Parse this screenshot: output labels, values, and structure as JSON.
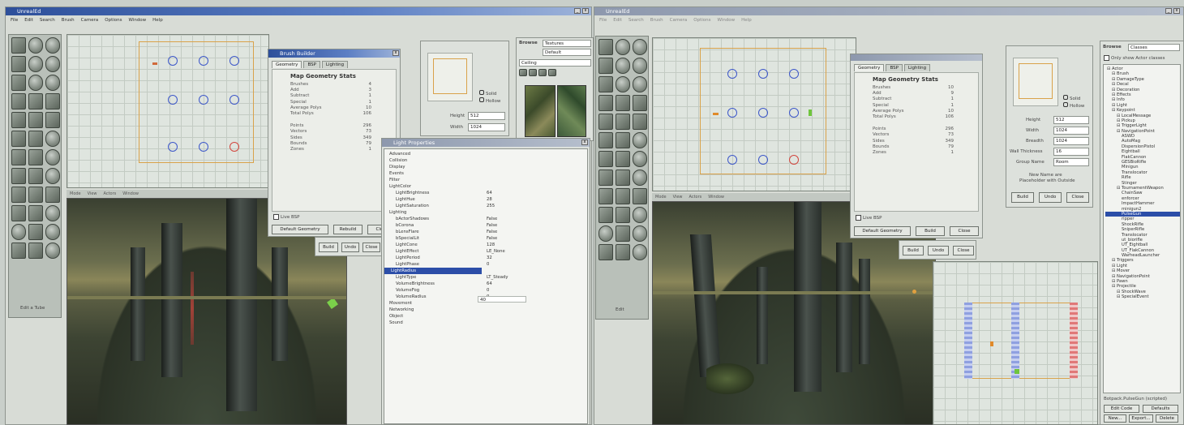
{
  "left_window": {
    "title": "UnrealEd",
    "menu": [
      "File",
      "Edit",
      "Search",
      "Brush",
      "Camera",
      "Options",
      "Window",
      "Help"
    ],
    "toolbox_caption": "Edit a Tube",
    "geometry_dialog": {
      "title": "Brush Builder",
      "tabs": [
        "Geometry",
        "BSP",
        "Lighting"
      ],
      "heading": "Map Geometry Stats",
      "stats": [
        {
          "label": "Brushes",
          "value": "4"
        },
        {
          "label": "Add",
          "value": "3"
        },
        {
          "label": "Subtract",
          "value": "1"
        },
        {
          "label": "Special",
          "value": "1"
        },
        {
          "label": "Average Polys",
          "value": "10"
        },
        {
          "label": "Total Polys",
          "value": "106"
        },
        {
          "label": "Points",
          "value": "296"
        },
        {
          "label": "Vectors",
          "value": "73"
        },
        {
          "label": "Sides",
          "value": "349"
        },
        {
          "label": "Bounds",
          "value": "79"
        },
        {
          "label": "Zones",
          "value": "1"
        }
      ],
      "checkbox_label": "Live BSP",
      "button_labels": [
        "Default Geometry",
        "Rebuild",
        "Close"
      ]
    },
    "sheet_panel": {
      "solid_label": "Solid",
      "hollow_label": "Hollow",
      "height_label": "Height",
      "height_value": "512",
      "width_label": "Width",
      "width_value": "1024",
      "button_labels": [
        "Build",
        "Undo",
        "Close"
      ]
    },
    "browser": {
      "label": "Browse",
      "value": "Textures",
      "sub1": "Default",
      "sub2": "Ceiling"
    },
    "viewport_menu": [
      "Mode",
      "View",
      "Actors",
      "Window"
    ]
  },
  "properties": {
    "title": "Light Properties",
    "rows": [
      {
        "key": "Advanced",
        "value": ""
      },
      {
        "key": "Collision",
        "value": ""
      },
      {
        "key": "Display",
        "value": ""
      },
      {
        "key": "Events",
        "value": ""
      },
      {
        "key": "Filter",
        "value": ""
      },
      {
        "key": "LightColor",
        "value": ""
      },
      {
        "key": "LightBrightness",
        "value": "64"
      },
      {
        "key": "LightHue",
        "value": "28"
      },
      {
        "key": "LightSaturation",
        "value": "255"
      },
      {
        "key": "Lighting",
        "value": ""
      },
      {
        "key": "bActorShadows",
        "value": "False"
      },
      {
        "key": "bCorona",
        "value": "False"
      },
      {
        "key": "bLensFlare",
        "value": "False"
      },
      {
        "key": "bSpecialLit",
        "value": "False"
      },
      {
        "key": "LightCone",
        "value": "128"
      },
      {
        "key": "LightEffect",
        "value": "LE_None"
      },
      {
        "key": "LightPeriod",
        "value": "32"
      },
      {
        "key": "LightPhase",
        "value": "0"
      },
      {
        "key": "LightRadius",
        "value": "40"
      },
      {
        "key": "LightType",
        "value": "LT_Steady"
      },
      {
        "key": "VolumeBrightness",
        "value": "64"
      },
      {
        "key": "VolumeFog",
        "value": "0"
      },
      {
        "key": "VolumeRadius",
        "value": "0"
      },
      {
        "key": "Movement",
        "value": ""
      },
      {
        "key": "Networking",
        "value": ""
      },
      {
        "key": "Object",
        "value": ""
      },
      {
        "key": "Sound",
        "value": ""
      }
    ]
  },
  "right_window": {
    "title": "UnrealEd",
    "menu": [
      "File",
      "Edit",
      "Search",
      "Brush",
      "Camera",
      "Options",
      "Window",
      "Help"
    ],
    "toolbox_caption": "Edit",
    "geometry_dialog": {
      "tabs": [
        "Geometry",
        "BSP",
        "Lighting"
      ],
      "heading": "Map Geometry Stats",
      "stats": [
        {
          "label": "Brushes",
          "value": "10"
        },
        {
          "label": "Add",
          "value": "9"
        },
        {
          "label": "Subtract",
          "value": "1"
        },
        {
          "label": "Special",
          "value": "1"
        },
        {
          "label": "Average Polys",
          "value": "10"
        },
        {
          "label": "Total Polys",
          "value": "106"
        },
        {
          "label": "Points",
          "value": "296"
        },
        {
          "label": "Vectors",
          "value": "73"
        },
        {
          "label": "Sides",
          "value": "349"
        },
        {
          "label": "Bounds",
          "value": "79"
        },
        {
          "label": "Zones",
          "value": "1"
        }
      ],
      "checkbox_label": "Live BSP",
      "button_labels": [
        "Default Geometry",
        "Build",
        "Close"
      ]
    },
    "sheet_panel": {
      "solid_label": "Solid",
      "hollow_label": "Hollow",
      "fields": [
        {
          "label": "Height",
          "value": "512"
        },
        {
          "label": "Width",
          "value": "1024"
        },
        {
          "label": "Breadth",
          "value": "1024"
        },
        {
          "label": "Wall Thickness",
          "value": "16"
        },
        {
          "label": "Group Name",
          "value": "Room"
        }
      ],
      "note1": "New Name are",
      "note2": "Placeholder with Outside",
      "button_labels": [
        "Build",
        "Undo",
        "Close"
      ]
    },
    "bottom_buttons": [
      "Build",
      "Undo",
      "Close"
    ],
    "viewport_menu": [
      "Mode",
      "View",
      "Actors",
      "Window"
    ],
    "browser": {
      "label": "Browse",
      "value": "Classes",
      "option": "Only show Actor classes",
      "tree": [
        {
          "t": "Actor",
          "d": 0
        },
        {
          "t": "Brush",
          "d": 1
        },
        {
          "t": "DamageType",
          "d": 1
        },
        {
          "t": "Decal",
          "d": 1
        },
        {
          "t": "Decoration",
          "d": 1
        },
        {
          "t": "Effects",
          "d": 1
        },
        {
          "t": "Info",
          "d": 1
        },
        {
          "t": "Light",
          "d": 1
        },
        {
          "t": "Keypoint",
          "d": 1
        },
        {
          "t": "LocalMessage",
          "d": 2
        },
        {
          "t": "Pickup",
          "d": 2
        },
        {
          "t": "TriggerLight",
          "d": 2
        },
        {
          "t": "NavigationPoint",
          "d": 2
        },
        {
          "t": "ASWD",
          "d": 3
        },
        {
          "t": "AutoMag",
          "d": 3
        },
        {
          "t": "DispersionPistol",
          "d": 3
        },
        {
          "t": "Eightball",
          "d": 3
        },
        {
          "t": "FlakCannon",
          "d": 3
        },
        {
          "t": "GESBioRifle",
          "d": 3
        },
        {
          "t": "Minigun",
          "d": 3
        },
        {
          "t": "Translocator",
          "d": 3
        },
        {
          "t": "Rifle",
          "d": 3
        },
        {
          "t": "Stinger",
          "d": 3
        },
        {
          "t": "TournamentWeapon",
          "d": 2
        },
        {
          "t": "ChainSaw",
          "d": 3
        },
        {
          "t": "enforcer",
          "d": 3
        },
        {
          "t": "ImpactHammer",
          "d": 3
        },
        {
          "t": "minigun2",
          "d": 3
        },
        {
          "t": "PulseGun",
          "d": 3,
          "sel": true
        },
        {
          "t": "ripper",
          "d": 3
        },
        {
          "t": "ShockRifle",
          "d": 3
        },
        {
          "t": "SniperRifle",
          "d": 3
        },
        {
          "t": "Translocator",
          "d": 3
        },
        {
          "t": "ut_biorifle",
          "d": 3
        },
        {
          "t": "UT_Eightball",
          "d": 3
        },
        {
          "t": "UT_FlakCannon",
          "d": 3
        },
        {
          "t": "WarheadLauncher",
          "d": 3
        },
        {
          "t": "Triggers",
          "d": 1
        },
        {
          "t": "Light",
          "d": 1
        },
        {
          "t": "Mover",
          "d": 1
        },
        {
          "t": "NavigationPoint",
          "d": 1
        },
        {
          "t": "Pawn",
          "d": 1
        },
        {
          "t": "Projectile",
          "d": 1
        },
        {
          "t": "ShockWave",
          "d": 2
        },
        {
          "t": "SpecialEvent",
          "d": 2
        }
      ],
      "status": "Botpack.PulseGun (scripted)",
      "bottom_buttons": [
        "Edit Code",
        "Defaults"
      ],
      "bottom_buttons2": [
        "New...",
        "Export...",
        "Delete"
      ]
    }
  }
}
